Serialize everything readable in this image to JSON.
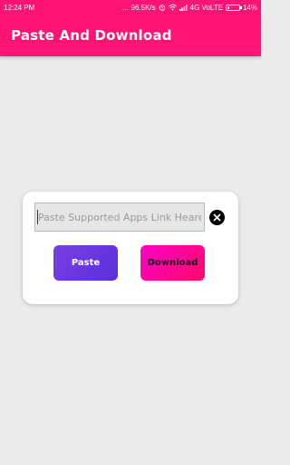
{
  "status_bar": {
    "time": "12:24 PM",
    "indicators": "...",
    "net_speed": "96.5K/s",
    "network": "4G VoLTE",
    "battery_level": "14%",
    "battery_fraction": 0.14,
    "icons": [
      "alarm-icon",
      "wifi-icon",
      "signal-icon",
      "battery-icon"
    ]
  },
  "app_bar": {
    "title": "Paste And Download"
  },
  "card": {
    "link_input": {
      "value": "",
      "placeholder": "Paste Supported Apps Link Heare"
    },
    "clear_icon": "close-circle-icon",
    "paste_label": "Paste",
    "download_label": "Download"
  },
  "colors": {
    "primary": "#fd1475",
    "paste_button": "#6a35e0",
    "download_button": "#ff03a0",
    "background": "#ebebeb"
  }
}
